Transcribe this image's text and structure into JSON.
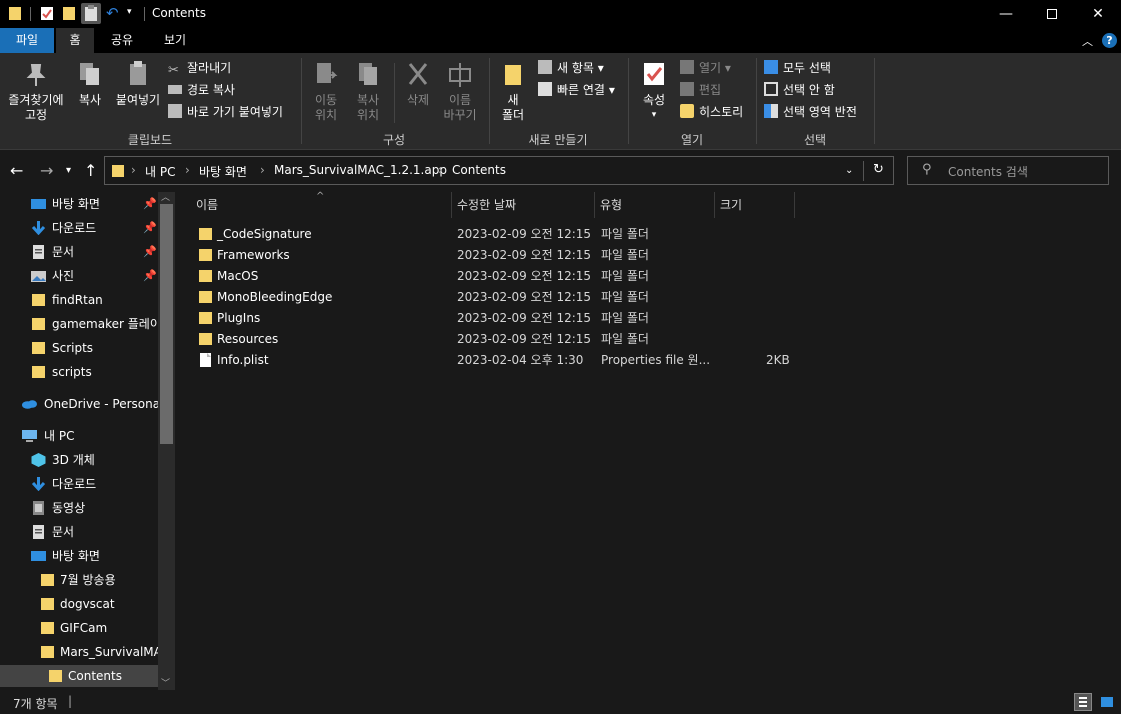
{
  "window": {
    "title": "Contents"
  },
  "ribbon_tabs": [
    {
      "label": "파일"
    },
    {
      "label": "홈"
    },
    {
      "label": "공유"
    },
    {
      "label": "보기"
    }
  ],
  "ribbon": {
    "clipboard": {
      "group_label": "클립보드",
      "pin_label_1": "즐겨찾기에",
      "pin_label_2": "고정",
      "copy_label": "복사",
      "paste_label": "붙여넣기",
      "cut_label": "잘라내기",
      "copy_path_label": "경로 복사",
      "paste_shortcut_label": "바로 가기 붙여넣기"
    },
    "organize": {
      "group_label": "구성",
      "move_label_1": "이동",
      "move_label_2": "위치",
      "copy_to_label_1": "복사",
      "copy_to_label_2": "위치",
      "delete_label": "삭제",
      "rename_label_1": "이름",
      "rename_label_2": "바꾸기"
    },
    "new": {
      "group_label": "새로 만들기",
      "new_folder_label_1": "새",
      "new_folder_label_2": "폴더",
      "new_item_label": "새 항목",
      "easy_access_label": "빠른 연결"
    },
    "open": {
      "group_label": "열기",
      "properties_label": "속성",
      "open_label": "열기",
      "edit_label": "편집",
      "history_label": "히스토리"
    },
    "select": {
      "group_label": "선택",
      "select_all_label": "모두 선택",
      "select_none_label": "선택 안 함",
      "invert_label": "선택 영역 반전"
    }
  },
  "address": {
    "crumbs": [
      "내 PC",
      "바탕 화면",
      "Mars_SurvivalMAC_1.2.1.app",
      "Contents"
    ],
    "search_placeholder": "Contents 검색"
  },
  "nav": {
    "quick_access": [
      {
        "label": "바탕 화면",
        "pinned": true
      },
      {
        "label": "다운로드",
        "pinned": true
      },
      {
        "label": "문서",
        "pinned": true
      },
      {
        "label": "사진",
        "pinned": true
      },
      {
        "label": "findRtan"
      },
      {
        "label": "gamemaker 플레이"
      },
      {
        "label": "Scripts"
      },
      {
        "label": "scripts"
      }
    ],
    "onedrive": "OneDrive - Personal",
    "this_pc": "내 PC",
    "pc_items": [
      {
        "label": "3D 개체"
      },
      {
        "label": "다운로드"
      },
      {
        "label": "동영상"
      },
      {
        "label": "문서"
      },
      {
        "label": "바탕 화면"
      }
    ],
    "desktop_children": [
      {
        "label": "7월 방송용"
      },
      {
        "label": "dogvscat"
      },
      {
        "label": "GIFCam"
      },
      {
        "label": "Mars_SurvivalMAC"
      },
      {
        "label": "Contents"
      }
    ]
  },
  "columns": {
    "name": "이름",
    "modified": "수정한 날짜",
    "type": "유형",
    "size": "크기"
  },
  "files": [
    {
      "name": "_CodeSignature",
      "modified": "2023-02-09 오전 12:15",
      "type": "파일 폴더",
      "size": ""
    },
    {
      "name": "Frameworks",
      "modified": "2023-02-09 오전 12:15",
      "type": "파일 폴더",
      "size": ""
    },
    {
      "name": "MacOS",
      "modified": "2023-02-09 오전 12:15",
      "type": "파일 폴더",
      "size": ""
    },
    {
      "name": "MonoBleedingEdge",
      "modified": "2023-02-09 오전 12:15",
      "type": "파일 폴더",
      "size": ""
    },
    {
      "name": "PlugIns",
      "modified": "2023-02-09 오전 12:15",
      "type": "파일 폴더",
      "size": ""
    },
    {
      "name": "Resources",
      "modified": "2023-02-09 오전 12:15",
      "type": "파일 폴더",
      "size": ""
    },
    {
      "name": "Info.plist",
      "modified": "2023-02-04 오후 1:30",
      "type": "Properties file 원...",
      "size": "2KB"
    }
  ],
  "status": {
    "item_count": "7개 항목"
  },
  "colors": {
    "accent": "#1a6fb7",
    "folder": "#f5d36b",
    "background": "#191919",
    "ribbon": "#2b2b2b"
  }
}
